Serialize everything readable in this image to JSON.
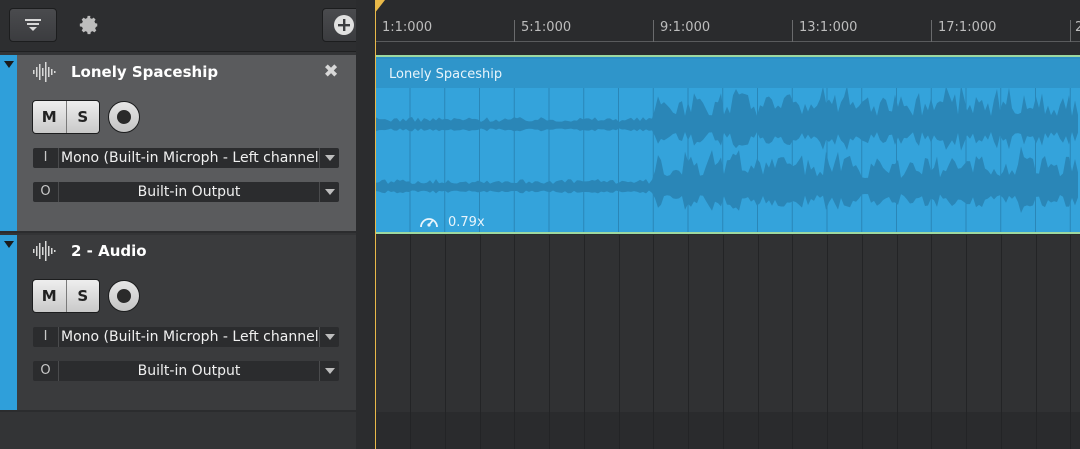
{
  "toolbar": {
    "menu_icon": "track-menu-icon",
    "settings_icon": "gear-icon",
    "add_icon": "add-track-icon"
  },
  "tracks": [
    {
      "name": "Lonely Spaceship",
      "mute_label": "M",
      "solo_label": "S",
      "input_prefix": "I",
      "input_value": "Mono (Built-in Microph - Left channel)",
      "output_prefix": "O",
      "output_value": "Built-in Output",
      "close_label": "✖"
    },
    {
      "name": "2 - Audio",
      "mute_label": "M",
      "solo_label": "S",
      "input_prefix": "I",
      "input_value": "Mono (Built-in Microph - Left channel)",
      "output_prefix": "O",
      "output_value": "Built-in Output"
    }
  ],
  "ruler": {
    "markers": [
      "1:1:000",
      "5:1:000",
      "9:1:000",
      "13:1:000",
      "17:1:000",
      "2"
    ]
  },
  "clip": {
    "name": "Lonely Spaceship",
    "speed": "0.79x"
  },
  "colors": {
    "accent_blue": "#2f9fda",
    "clip_blue": "#34a3db",
    "playhead": "#e9b949",
    "clip_border": "#9ed8a0"
  }
}
